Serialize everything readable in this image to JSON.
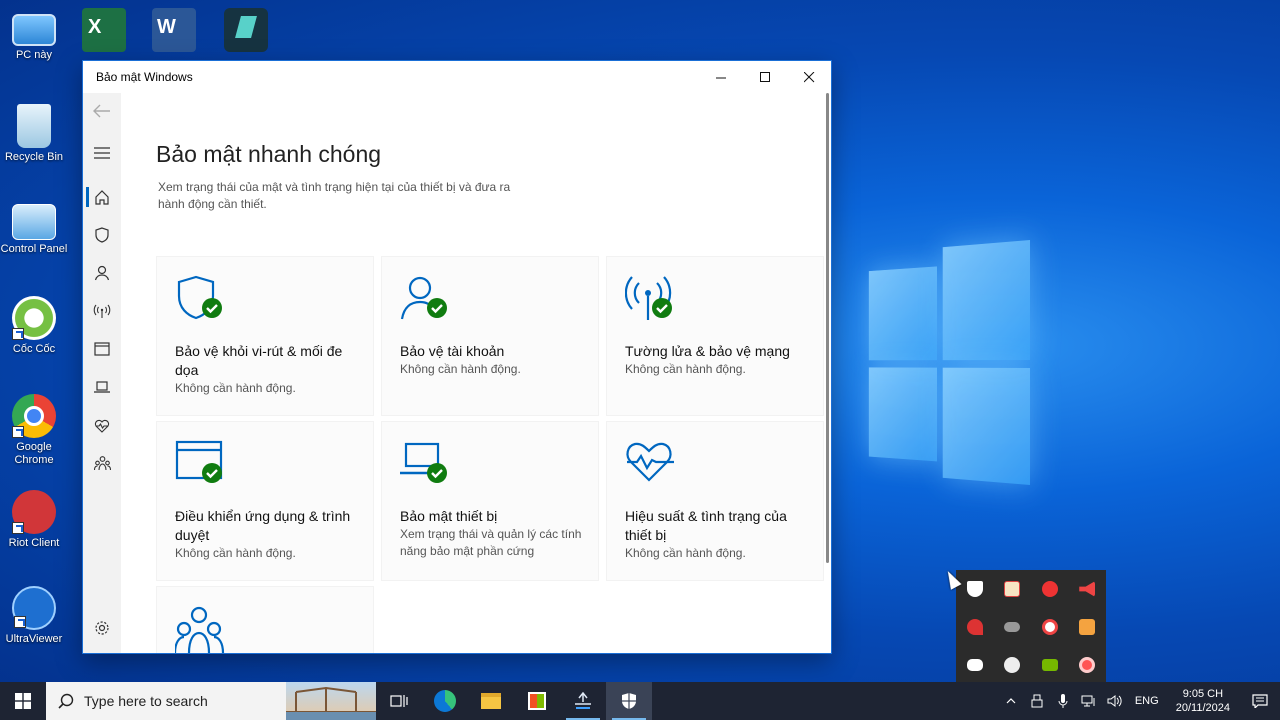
{
  "desktop": {
    "icons": [
      {
        "label": "PC này"
      },
      {
        "label": "Recycle Bin"
      },
      {
        "label": "Control Panel"
      },
      {
        "label": "Cốc Cốc"
      },
      {
        "label": "Google Chrome"
      },
      {
        "label": "Riot Client"
      },
      {
        "label": "UltraViewer"
      }
    ]
  },
  "window": {
    "title": "Bảo mật Windows",
    "heading": "Bảo mật nhanh chóng",
    "subtitle": "Xem trạng thái của mật và tình trạng hiện tại của thiết bị và đưa ra hành động cần thiết.",
    "cards": [
      {
        "name": "Bảo vệ khỏi vi-rút & mối đe dọa",
        "status": "Không cần hành động.",
        "icon": "shield-check-icon"
      },
      {
        "name": "Bảo vệ tài khoản",
        "status": "Không cần hành động.",
        "icon": "person-check-icon"
      },
      {
        "name": "Tường lửa & bảo vệ mạng",
        "status": "Không cần hành động.",
        "icon": "antenna-check-icon"
      },
      {
        "name": "Điều khiển ứng dụng & trình duyệt",
        "status": "Không cần hành động.",
        "icon": "browser-check-icon"
      },
      {
        "name": "Bảo mật thiết bị",
        "status": "Xem trạng thái và quản lý các tính năng bảo mật phần cứng",
        "icon": "laptop-check-icon"
      },
      {
        "name": "Hiệu suất & tình trạng của thiết bị",
        "status": "Không cần hành động.",
        "icon": "heart-pulse-icon"
      }
    ]
  },
  "taskbar": {
    "search_placeholder": "Type here to search",
    "language": "ENG",
    "time": "9:05 CH",
    "date": "20/11/2024"
  },
  "colors": {
    "accent": "#0067c0",
    "ok_green": "#107c10",
    "icon_blue": "#0067c0"
  }
}
